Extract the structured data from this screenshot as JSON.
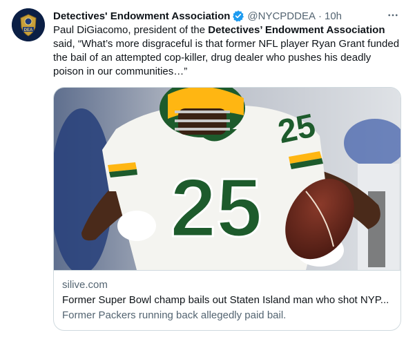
{
  "tweet": {
    "author_name": "Detectives' Endowment Association",
    "handle": "@NYCPDDEA",
    "separator": "·",
    "time": "10h",
    "more_icon": "more-horizontal-icon",
    "verified_icon": "verified-badge-icon",
    "avatar_text": "DEA",
    "text_part1": "Paul DiGiacomo, president of the ",
    "text_bold": "Detectives’ Endowment Association",
    "text_part2": " said, “What’s more disgraceful is that former NFL player Ryan Grant funded the bail of an attempted cop-killer, drug dealer who pushes his deadly poison in our communities…”"
  },
  "card": {
    "domain": "silive.com",
    "title": "Former Super Bowl champ bails out Staten Island man who shot NYP...",
    "description": "Former Packers running back allegedly paid bail.",
    "image": {
      "jersey_number": "25",
      "jersey_color": "#f4f4f0",
      "number_color": "#1d5b2c",
      "helmet_color": "#ffb612",
      "background_color": "#6d7890"
    }
  },
  "colors": {
    "text_primary": "#0f1419",
    "text_secondary": "#536471",
    "verified": "#1d9bf0",
    "border": "#cfd9de"
  }
}
